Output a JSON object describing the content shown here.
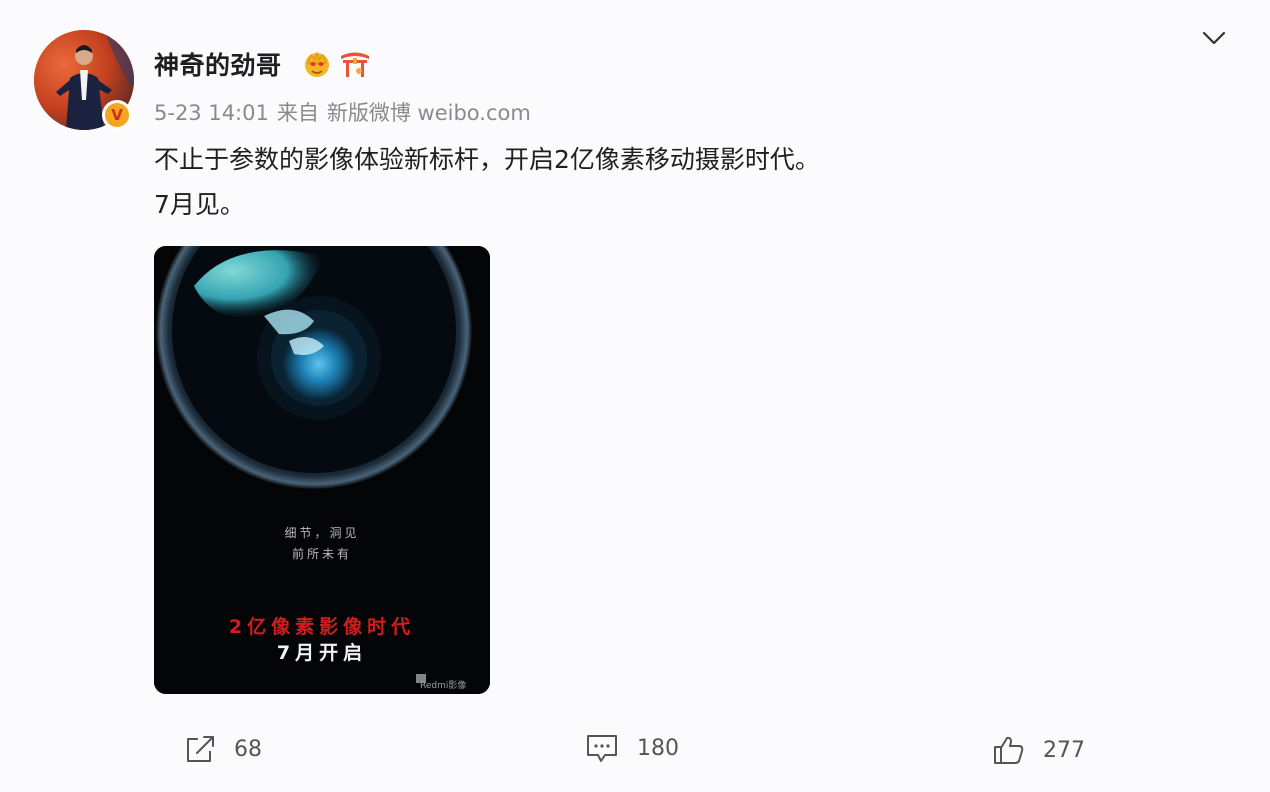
{
  "post": {
    "author": "神奇的劲哥",
    "timestamp": "5-23 14:01",
    "source_prefix": "来自",
    "source": "新版微博 weibo.com",
    "text_line_1": "不止于参数的影像体验新标杆，开启2亿像素移动摄影时代。",
    "text_line_2": "7月见。",
    "verified_mark": "V"
  },
  "poster": {
    "line_1": "细节，洞见",
    "line_2": "前所未有",
    "headline_red": "2亿像素影像时代",
    "headline_white": "7月开启",
    "brand": "Redmi影像"
  },
  "actions": {
    "share_count": "68",
    "comment_count": "180",
    "like_count": "277"
  },
  "icons": {
    "crown": "crown-badge-icon",
    "gate": "gate-badge-icon",
    "more": "chevron-down-icon",
    "share": "share-icon",
    "comment": "comment-icon",
    "like": "thumbs-up-icon"
  },
  "colors": {
    "background": "#fbfbfd",
    "meta_text": "#8a8a8a",
    "verified_badge": "#f4a521",
    "poster_red": "#d01d1d"
  }
}
